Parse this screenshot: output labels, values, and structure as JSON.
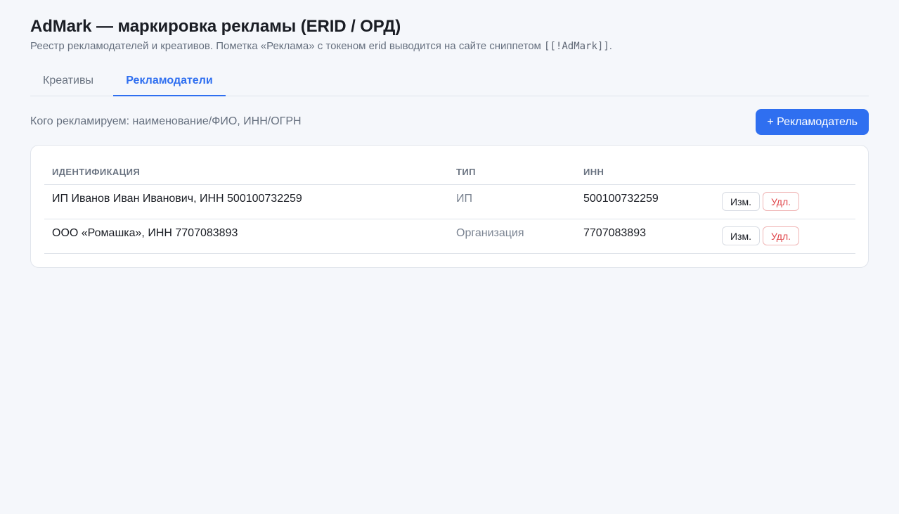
{
  "header": {
    "title": "AdMark — маркировка рекламы (ERID / ОРД)",
    "subtitle_prefix": "Реестр рекламодателей и креативов. Пометка «Реклама» с токеном erid выводится на сайте сниппетом",
    "snippet": "[[!AdMark]]",
    "subtitle_suffix": "."
  },
  "tabs": [
    {
      "label": "Креативы",
      "active": false
    },
    {
      "label": "Рекламодатели",
      "active": true
    }
  ],
  "toolbar": {
    "hint": "Кого рекламируем: наименование/ФИО, ИНН/ОГРН",
    "add_label": "+ Рекламодатель"
  },
  "table": {
    "columns": [
      "ИДЕНТИФИКАЦИЯ",
      "ТИП",
      "ИНН"
    ],
    "rows": [
      {
        "ident": "ИП Иванов Иван Иванович, ИНН 500100732259",
        "type": "ИП",
        "inn": "500100732259",
        "edit": "Изм.",
        "delete": "Удл."
      },
      {
        "ident": "ООО «Ромашка», ИНН 7707083893",
        "type": "Организация",
        "inn": "7707083893",
        "edit": "Изм.",
        "delete": "Удл."
      }
    ]
  },
  "colors": {
    "accent": "#2f6ff0",
    "danger": "#e0474c",
    "background": "#f5f7fb"
  }
}
